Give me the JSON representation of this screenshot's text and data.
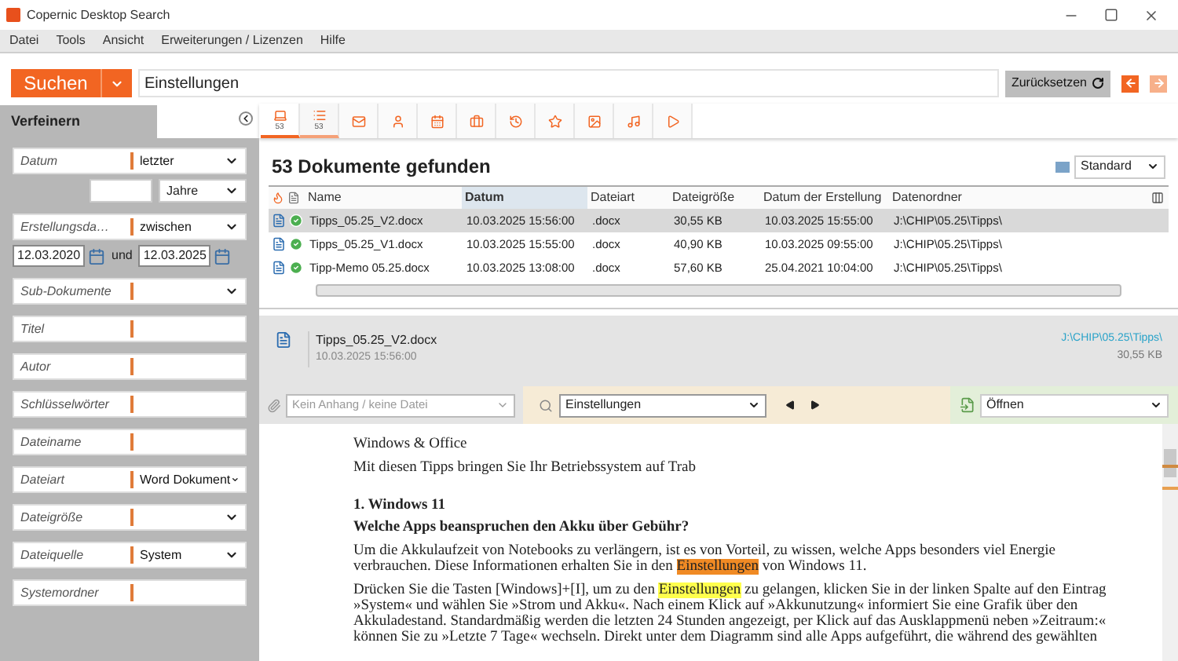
{
  "window": {
    "title": "Copernic Desktop Search"
  },
  "menu": [
    "Datei",
    "Tools",
    "Ansicht",
    "Erweiterungen / Lizenzen",
    "Hilfe"
  ],
  "search": {
    "button": "Suchen",
    "value": "Einstellungen",
    "reset": "Zurücksetzen",
    "back_disabled": false,
    "forward_disabled": true
  },
  "refine": {
    "title": "Verfeinern",
    "filters": [
      {
        "kind": "relative",
        "label": "Datum",
        "value": "letzter",
        "unit": "Jahre"
      },
      {
        "kind": "range",
        "label": "Erstellungsda…",
        "value": "zwischen",
        "from": "12.03.2020",
        "joiner": "und",
        "to": "12.03.2025"
      },
      {
        "kind": "dropdown",
        "label": "Sub-Dokumente"
      },
      {
        "kind": "text",
        "label": "Titel"
      },
      {
        "kind": "text",
        "label": "Autor"
      },
      {
        "kind": "text",
        "label": "Schlüsselwörter"
      },
      {
        "kind": "text",
        "label": "Dateiname"
      },
      {
        "kind": "dropdown",
        "label": "Dateiart",
        "value": "Word Dokument"
      },
      {
        "kind": "dropdown",
        "label": "Dateigröße"
      },
      {
        "kind": "dropdown",
        "label": "Dateiquelle",
        "value": "System"
      },
      {
        "kind": "text",
        "label": "Systemordner"
      }
    ]
  },
  "categories": [
    {
      "kind": "computer",
      "count": "53",
      "selected": true
    },
    {
      "kind": "list",
      "count": "53",
      "selected": false
    },
    {
      "kind": "mail",
      "selected": false
    },
    {
      "kind": "contact",
      "selected": false
    },
    {
      "kind": "calendar",
      "selected": false
    },
    {
      "kind": "office",
      "selected": false
    },
    {
      "kind": "history",
      "selected": false
    },
    {
      "kind": "star",
      "selected": false
    },
    {
      "kind": "picture",
      "selected": false
    },
    {
      "kind": "music",
      "selected": false
    },
    {
      "kind": "video",
      "selected": false
    }
  ],
  "results": {
    "title": "53 Dokumente gefunden",
    "view": "Standard",
    "columns": [
      {
        "label": "Name",
        "sorted": false
      },
      {
        "label": "Datum",
        "sorted": true
      },
      {
        "label": "Dateiart",
        "sorted": false
      },
      {
        "label": "Dateigröße",
        "sorted": false
      },
      {
        "label": "Datum der Erstellung",
        "sorted": false
      },
      {
        "label": "Datenordner",
        "sorted": false
      }
    ],
    "rows": [
      {
        "selected": true,
        "cells": [
          "Tipps_05.25_V2.docx",
          "10.03.2025 15:56:00",
          ".docx",
          "30,55 KB",
          "10.03.2025 15:55:00",
          "J:\\CHIP\\05.25\\Tipps\\"
        ]
      },
      {
        "selected": false,
        "cells": [
          "Tipps_05.25_V1.docx",
          "10.03.2025 15:55:00",
          ".docx",
          "40,90 KB",
          "10.03.2025 09:55:00",
          "J:\\CHIP\\05.25\\Tipps\\"
        ]
      },
      {
        "selected": false,
        "cells": [
          "Tipp-Memo 05.25.docx",
          "10.03.2025 13:08:00",
          ".docx",
          "57,60 KB",
          "25.04.2021 10:04:00",
          "J:\\CHIP\\05.25\\Tipps\\"
        ]
      }
    ]
  },
  "preview": {
    "name": "Tipps_05.25_V2.docx",
    "date": "10.03.2025 15:56:00",
    "path": "J:\\CHIP\\05.25\\Tipps\\",
    "size": "30,55 KB"
  },
  "toolbar": {
    "attachment_placeholder": "Kein Anhang / keine Datei",
    "term": "Einstellungen",
    "action": "Öffnen"
  },
  "document": [
    {
      "kind": "line",
      "parts": [
        {
          "text": "Windows & Office"
        }
      ]
    },
    {
      "kind": "line",
      "parts": [
        {
          "text": "Mit diesen Tipps bringen Sie Ihr Betriebssystem auf Trab"
        }
      ]
    },
    {
      "kind": "heading",
      "parts": [
        {
          "text": "1. Windows 11"
        }
      ]
    },
    {
      "kind": "heading",
      "parts": [
        {
          "text": "Welche Apps beanspruchen den Akku über Gebühr?"
        }
      ]
    },
    {
      "kind": "paragraph",
      "parts": [
        {
          "text": "Um die Akkulaufzeit von Notebooks zu verlängern, ist es von Vorteil, zu wissen, welche Apps besonders viel Energie verbrauchen. Diese Informationen erhalten Sie in den "
        },
        {
          "text": "Einstellungen",
          "highlighted": true,
          "current": true
        },
        {
          "text": " von Windows 11."
        }
      ]
    },
    {
      "kind": "paragraph",
      "parts": [
        {
          "text": "Drücken Sie die Tasten [Windows]+[I], um zu den "
        },
        {
          "text": "Einstellungen",
          "highlighted": true,
          "current": false
        },
        {
          "text": " zu gelangen, klicken Sie in der linken Spalte auf den Eintrag »System« und wählen Sie »Strom und Akku«. Nach einem Klick auf »Akkunutzung« informiert Sie eine Grafik über den Akkuladestand. Standardmäßig werden die letzten 24 Stunden angezeigt, per Klick auf das Ausklappmenü neben »Zeitraum:« können Sie zu »Letzte 7 Tage« wechseln. Direkt unter dem Diagramm sind alle Apps aufgeführt, die während des gewählten"
        }
      ]
    }
  ]
}
